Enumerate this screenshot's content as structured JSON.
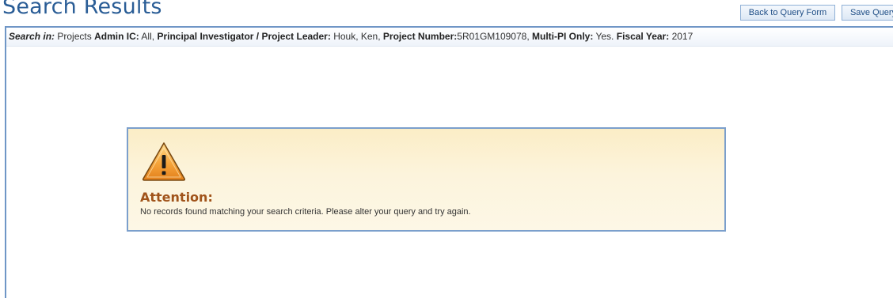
{
  "header": {
    "title": "Search Results",
    "back_button_label": "Back to Query Form",
    "save_button_label": "Save Query"
  },
  "criteria": {
    "search_in_label": "Search in:",
    "search_in_value": "Projects",
    "admin_ic_label": "Admin IC:",
    "admin_ic_value": "All,",
    "pi_label": "Principal Investigator / Project Leader:",
    "pi_value": "Houk, Ken,",
    "project_number_label": "Project Number:",
    "project_number_value": "5R01GM109078,",
    "multi_pi_label": "Multi-PI Only:",
    "multi_pi_value": "Yes.",
    "fiscal_year_label": "Fiscal Year:",
    "fiscal_year_value": "2017"
  },
  "attention": {
    "icon": "warning-triangle-icon",
    "title": "Attention:",
    "message": "No records found matching your search criteria. Please alter your query and try again."
  },
  "colors": {
    "title_blue": "#2a5d96",
    "panel_border": "#6f96c6",
    "attention_bg": "#fcf4dc",
    "attention_title": "#a0531a",
    "warning_orange": "#f0a030"
  }
}
